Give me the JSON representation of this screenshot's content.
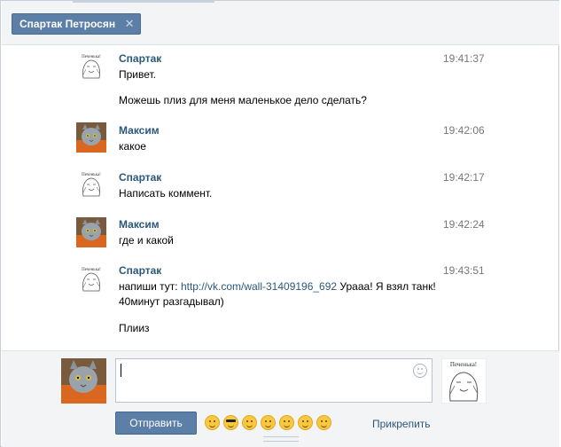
{
  "chat": {
    "participant_chip": "Спартак Петросян",
    "close_symbol": "✕"
  },
  "messages": [
    {
      "author": "Спартак",
      "time": "19:41:37",
      "lines": [
        "Привет.",
        "Можешь плиз для меня маленькое дело сделать?"
      ]
    },
    {
      "author": "Максим",
      "time": "19:42:06",
      "lines": [
        "какое"
      ]
    },
    {
      "author": "Спартак",
      "time": "19:42:17",
      "lines": [
        "Написать коммент."
      ]
    },
    {
      "author": "Максим",
      "time": "19:42:24",
      "lines": [
        "где и какой"
      ]
    },
    {
      "author": "Спартак",
      "time": "19:43:51",
      "text_before_link": "напиши тут: ",
      "link": "http://vk.com/wall-31409196_692",
      "text_after_link": " Урааа! Я взял танк! 40минут разгадывал)",
      "extra_line": "Плииз"
    }
  ],
  "avatars": {
    "spartak_caption": "Печенька!",
    "peer_caption": "Печенька!"
  },
  "composer": {
    "input_value": "",
    "send_label": "Отправить",
    "attach_label": "Прикрепить",
    "emoji_names": [
      "wink-emoji",
      "sunglasses-emoji",
      "grin-emoji",
      "laughing-emoji",
      "blush-emoji",
      "flushed-emoji",
      "kissing-emoji"
    ]
  },
  "colors": {
    "accent": "#5b7fa6",
    "link": "#2b587a",
    "header_bg": "#f3f4f6"
  }
}
